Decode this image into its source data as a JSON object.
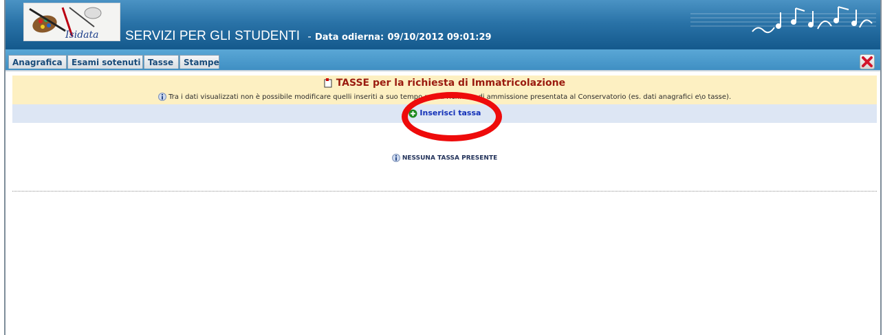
{
  "header": {
    "logo_text": "Isidata",
    "app_title": "SERVIZI PER GLI STUDENTI",
    "separator": "-",
    "date_label": "Data odierna:",
    "date_value": "09/10/2012 09:01:29"
  },
  "tabs": [
    {
      "label": "Anagrafica"
    },
    {
      "label": "Esami sotenuti"
    },
    {
      "label": "Tasse"
    },
    {
      "label": "Stampe"
    }
  ],
  "page": {
    "title": "TASSE per la richiesta di Immatricolazione",
    "info_text": "Tra i dati visualizzati non è possibile modificare quelli inseriti a suo tempo per la richiesta di ammissione presentata al Conservatorio (es. dati anagrafici e\\o tasse).",
    "add_link": "Inserisci tassa",
    "empty_message": "NESSUNA TASSA PRESENTE"
  },
  "colors": {
    "header_top": "#4b93c4",
    "header_bottom": "#14598c",
    "title_band": "#fdf0c2",
    "add_band": "#dde6f4",
    "title_text": "#9a1b0f",
    "link_text": "#1230b8",
    "highlight": "#ee0b0b"
  }
}
